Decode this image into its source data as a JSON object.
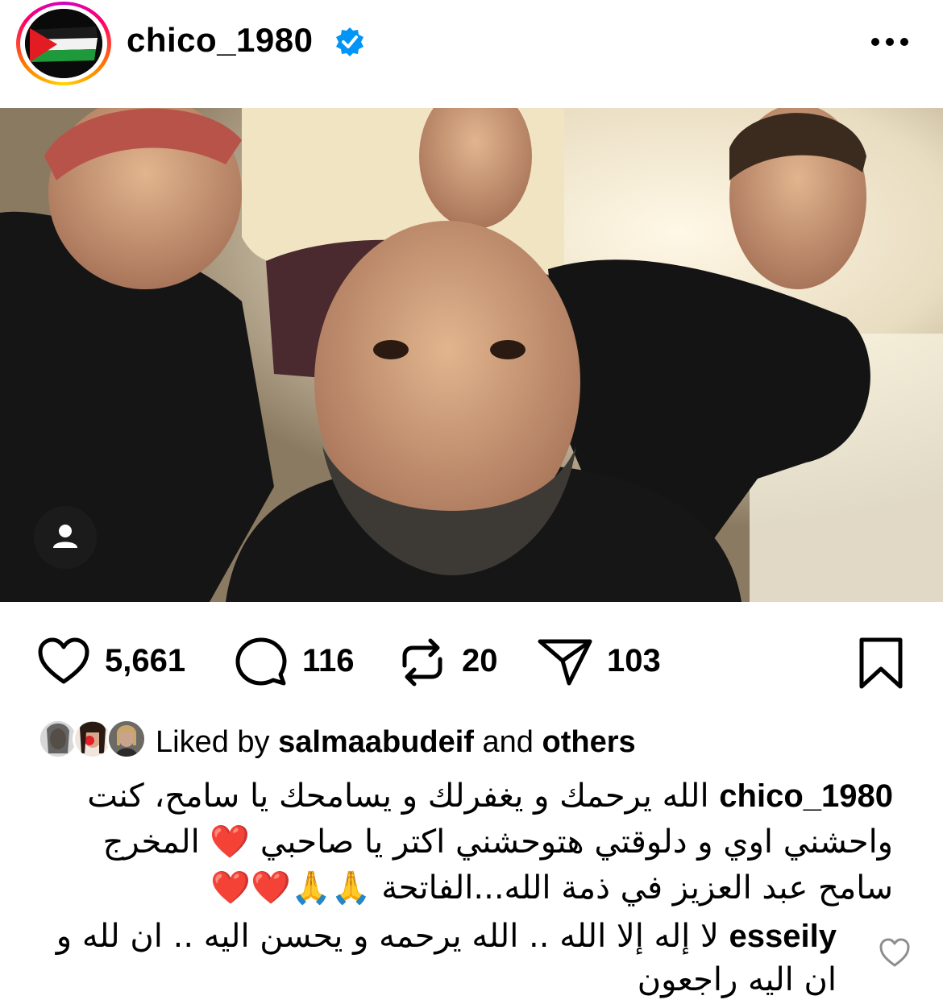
{
  "post": {
    "username": "chico_1980",
    "verified_icon": "verified-badge-icon",
    "more_icon": "more-options-icon"
  },
  "photo": {
    "tag_icon": "person-icon"
  },
  "actions": {
    "likes": "5,661",
    "comments": "116",
    "reposts": "20",
    "shares": "103",
    "like_icon": "heart-icon",
    "comment_icon": "comment-icon",
    "repost_icon": "repost-icon",
    "share_icon": "send-icon",
    "save_icon": "bookmark-icon"
  },
  "liked_by": {
    "prefix": "Liked by ",
    "user": "salmaabudeif",
    "middle": " and ",
    "others": "others"
  },
  "caption": {
    "username": "chico_1980",
    "text": "الله يرحمك و يغفرلك و يسامحك يا سامح، كنت واحشني اوي و دلوقتي هتوحشني اكتر يا صاحبي ❤️ المخرج سامح عبد العزيز في ذمة الله...الفاتحة 🙏🙏❤️❤️"
  },
  "comment": {
    "username": "esseily",
    "text": "لا إله إلا الله .. الله يرحمه و يحسن اليه .. ان لله و ان اليه راجعون",
    "like_icon": "heart-outline-icon"
  },
  "colors": {
    "verified_blue": "#0095f6",
    "text": "#000000",
    "muted": "#8e8e8e"
  }
}
